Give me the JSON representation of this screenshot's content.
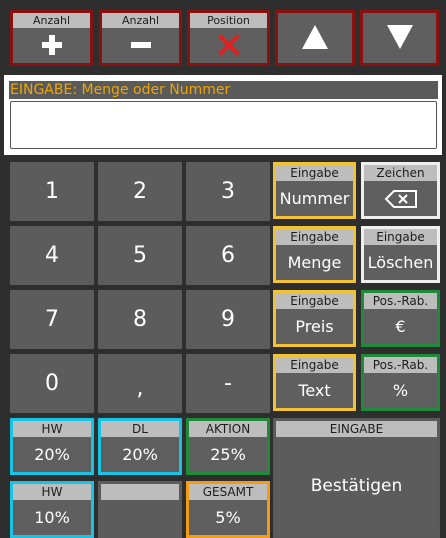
{
  "toolbar": {
    "add": {
      "caption": "Anzahl",
      "icon": "plus-icon"
    },
    "subtract": {
      "caption": "Anzahl",
      "icon": "minus-icon"
    },
    "delete": {
      "caption": "Position",
      "icon": "red-x-icon"
    },
    "up": {
      "icon": "triangle-up-icon"
    },
    "down": {
      "icon": "triangle-down-icon"
    },
    "border_color": "#8b1010"
  },
  "input": {
    "label": "EINGABE: Menge oder Nummer",
    "value": "",
    "label_color": "#f0a500"
  },
  "keypad": {
    "k1": "1",
    "k2": "2",
    "k3": "3",
    "k4": "4",
    "k5": "5",
    "k6": "6",
    "k7": "7",
    "k8": "8",
    "k9": "9",
    "k0": "0",
    "comma": ",",
    "minus": "-"
  },
  "functions": {
    "nummer": {
      "caption": "Eingabe",
      "label": "Nummer"
    },
    "zeichen": {
      "caption": "Zeichen",
      "icon": "backspace-icon"
    },
    "menge": {
      "caption": "Eingabe",
      "label": "Menge"
    },
    "loeschen": {
      "caption": "Eingabe",
      "label": "Löschen"
    },
    "preis": {
      "caption": "Eingabe",
      "label": "Preis"
    },
    "pos_rab_eur": {
      "caption": "Pos.-Rab.",
      "label": "€"
    },
    "text": {
      "caption": "Eingabe",
      "label": "Text"
    },
    "pos_rab_pct": {
      "caption": "Pos.-Rab.",
      "label": "%"
    }
  },
  "discounts": {
    "hw20": {
      "caption": "HW",
      "label": "20%"
    },
    "dl20": {
      "caption": "DL",
      "label": "20%"
    },
    "aktion25": {
      "caption": "AKTION",
      "label": "25%"
    },
    "hw10": {
      "caption": "HW",
      "label": "10%"
    },
    "empty": {
      "caption": "",
      "label": ""
    },
    "gesamt5": {
      "caption": "GESAMT",
      "label": "5%"
    }
  },
  "confirm": {
    "caption": "EINGABE",
    "label": "Bestätigen"
  },
  "colors": {
    "yellow": "#f1c232",
    "green": "#1f8a3a",
    "cyan": "#19c3e6",
    "orange": "#f39c12",
    "red": "#8b1010"
  }
}
